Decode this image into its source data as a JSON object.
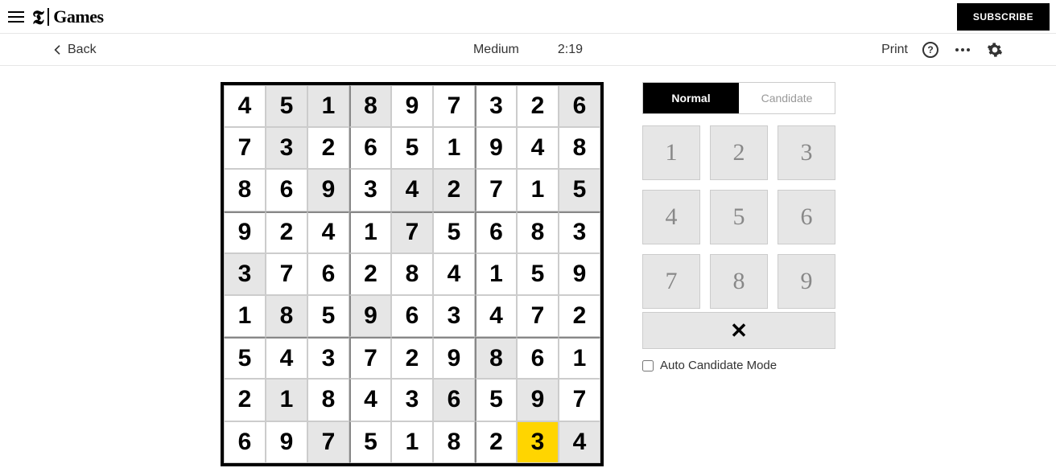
{
  "header": {
    "logo_games": "Games",
    "subscribe": "SUBSCRIBE"
  },
  "toolbar": {
    "back": "Back",
    "difficulty": "Medium",
    "timer": "2:19",
    "print": "Print"
  },
  "controls": {
    "mode_normal": "Normal",
    "mode_candidate": "Candidate",
    "numpad": [
      "1",
      "2",
      "3",
      "4",
      "5",
      "6",
      "7",
      "8",
      "9"
    ],
    "erase": "✕",
    "auto_candidate": "Auto Candidate Mode"
  },
  "sudoku": {
    "grid": [
      [
        {
          "v": "4",
          "p": false
        },
        {
          "v": "5",
          "p": true
        },
        {
          "v": "1",
          "p": true
        },
        {
          "v": "8",
          "p": true
        },
        {
          "v": "9",
          "p": false
        },
        {
          "v": "7",
          "p": false
        },
        {
          "v": "3",
          "p": false
        },
        {
          "v": "2",
          "p": false
        },
        {
          "v": "6",
          "p": true
        }
      ],
      [
        {
          "v": "7",
          "p": false
        },
        {
          "v": "3",
          "p": true
        },
        {
          "v": "2",
          "p": false
        },
        {
          "v": "6",
          "p": false
        },
        {
          "v": "5",
          "p": false
        },
        {
          "v": "1",
          "p": false
        },
        {
          "v": "9",
          "p": false
        },
        {
          "v": "4",
          "p": false
        },
        {
          "v": "8",
          "p": false
        }
      ],
      [
        {
          "v": "8",
          "p": false
        },
        {
          "v": "6",
          "p": false
        },
        {
          "v": "9",
          "p": true
        },
        {
          "v": "3",
          "p": false
        },
        {
          "v": "4",
          "p": true
        },
        {
          "v": "2",
          "p": true
        },
        {
          "v": "7",
          "p": false
        },
        {
          "v": "1",
          "p": false
        },
        {
          "v": "5",
          "p": true
        }
      ],
      [
        {
          "v": "9",
          "p": false
        },
        {
          "v": "2",
          "p": false
        },
        {
          "v": "4",
          "p": false
        },
        {
          "v": "1",
          "p": false
        },
        {
          "v": "7",
          "p": true
        },
        {
          "v": "5",
          "p": false
        },
        {
          "v": "6",
          "p": false
        },
        {
          "v": "8",
          "p": false
        },
        {
          "v": "3",
          "p": false
        }
      ],
      [
        {
          "v": "3",
          "p": true
        },
        {
          "v": "7",
          "p": false
        },
        {
          "v": "6",
          "p": false
        },
        {
          "v": "2",
          "p": false
        },
        {
          "v": "8",
          "p": false
        },
        {
          "v": "4",
          "p": false
        },
        {
          "v": "1",
          "p": false
        },
        {
          "v": "5",
          "p": false
        },
        {
          "v": "9",
          "p": false
        }
      ],
      [
        {
          "v": "1",
          "p": false
        },
        {
          "v": "8",
          "p": true
        },
        {
          "v": "5",
          "p": false
        },
        {
          "v": "9",
          "p": true
        },
        {
          "v": "6",
          "p": false
        },
        {
          "v": "3",
          "p": false
        },
        {
          "v": "4",
          "p": false
        },
        {
          "v": "7",
          "p": false
        },
        {
          "v": "2",
          "p": false
        }
      ],
      [
        {
          "v": "5",
          "p": false
        },
        {
          "v": "4",
          "p": false
        },
        {
          "v": "3",
          "p": false
        },
        {
          "v": "7",
          "p": false
        },
        {
          "v": "2",
          "p": false
        },
        {
          "v": "9",
          "p": false
        },
        {
          "v": "8",
          "p": true
        },
        {
          "v": "6",
          "p": false
        },
        {
          "v": "1",
          "p": false
        }
      ],
      [
        {
          "v": "2",
          "p": false
        },
        {
          "v": "1",
          "p": true
        },
        {
          "v": "8",
          "p": false
        },
        {
          "v": "4",
          "p": false
        },
        {
          "v": "3",
          "p": false
        },
        {
          "v": "6",
          "p": true
        },
        {
          "v": "5",
          "p": false
        },
        {
          "v": "9",
          "p": true
        },
        {
          "v": "7",
          "p": false
        }
      ],
      [
        {
          "v": "6",
          "p": false
        },
        {
          "v": "9",
          "p": false
        },
        {
          "v": "7",
          "p": true
        },
        {
          "v": "5",
          "p": false
        },
        {
          "v": "1",
          "p": false
        },
        {
          "v": "8",
          "p": false
        },
        {
          "v": "2",
          "p": false
        },
        {
          "v": "3",
          "p": false,
          "sel": true
        },
        {
          "v": "4",
          "p": true
        }
      ]
    ]
  }
}
